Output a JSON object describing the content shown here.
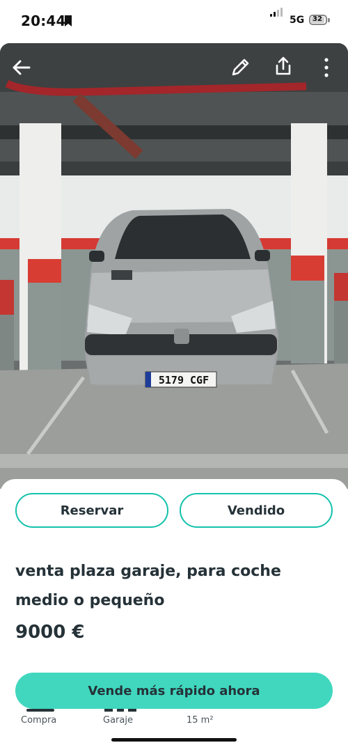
{
  "status_bar": {
    "time": "20:44",
    "network": "5G",
    "battery_level": "32"
  },
  "toolbar": {
    "icons": [
      "back-arrow-icon",
      "edit-pencil-icon",
      "share-icon",
      "more-vertical-icon"
    ]
  },
  "photo": {
    "license_plate": "5179 CGF"
  },
  "actions": {
    "reserve_label": "Reservar",
    "sold_label": "Vendido"
  },
  "listing": {
    "title": "venta plaza garaje, para coche medio o pequeño",
    "price": "9000 €"
  },
  "promote": {
    "label": "Vende más rápido ahora"
  },
  "details": [
    {
      "label": "Compra"
    },
    {
      "label": "Garaje"
    },
    {
      "label": "15 m²"
    }
  ],
  "colors": {
    "accent": "#13c1ac",
    "promote_bg": "#40d7be",
    "text": "#253238"
  }
}
